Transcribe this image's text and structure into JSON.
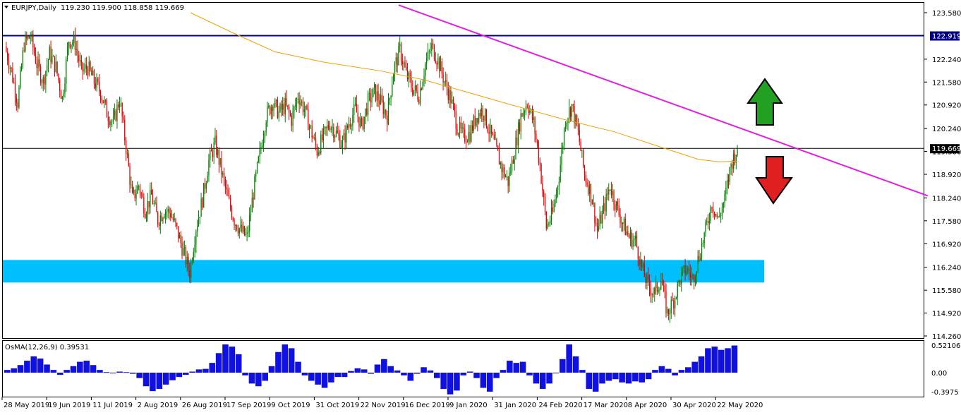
{
  "header": {
    "symbol_label": "EURJPY,Daily",
    "ohlc_text": "119.230 119.900 118.858 119.669"
  },
  "indicator": {
    "label": "OsMA(12,26,9) 0.39531",
    "ticks": [
      "0.52106",
      "0.00",
      "-0.3975"
    ]
  },
  "colors": {
    "background": "#ffffff",
    "bull_candle": "#008000",
    "bear_candle": "#e00000",
    "moving_average": "#f0a000",
    "trendline": "#e020e0",
    "resistance_line": "#000080",
    "support_zone": "#00bfff",
    "osma_histogram": "#1010e0",
    "arrow_up": "#22a022",
    "arrow_down": "#e02020"
  },
  "chart_data": {
    "type": "candlestick",
    "symbol": "EURJPY",
    "timeframe": "Daily",
    "ylim": [
      114.26,
      123.58
    ],
    "yticks": [
      "123.580",
      "122.240",
      "121.580",
      "120.920",
      "120.240",
      "119.580",
      "118.920",
      "118.240",
      "117.580",
      "116.920",
      "116.240",
      "115.580",
      "114.920",
      "114.260"
    ],
    "xlabels": [
      "28 May 2019",
      "19 Jun 2019",
      "11 Jul 2019",
      "2 Aug 2019",
      "26 Aug 2019",
      "17 Sep 2019",
      "9 Oct 2019",
      "31 Oct 2019",
      "22 Nov 2019",
      "16 Dec 2019",
      "9 Jan 2020",
      "31 Jan 2020",
      "24 Feb 2020",
      "17 Mar 2020",
      "8 Apr 2020",
      "30 Apr 2020",
      "22 May 2020"
    ],
    "price_markers": {
      "resistance": "122.919",
      "current": "119.669"
    },
    "price_path": [
      122.6,
      121.9,
      121.0,
      122.7,
      122.9,
      122.1,
      121.6,
      122.4,
      122.0,
      121.1,
      122.8,
      122.7,
      121.9,
      122.0,
      121.6,
      121.3,
      120.7,
      120.4,
      121.1,
      119.7,
      118.2,
      118.6,
      117.9,
      118.3,
      117.6,
      117.9,
      117.8,
      117.3,
      116.7,
      116.1,
      117.4,
      118.2,
      119.3,
      119.8,
      119.0,
      118.2,
      117.6,
      117.3,
      117.1,
      118.4,
      119.5,
      120.6,
      121.0,
      120.7,
      120.9,
      120.5,
      121.2,
      120.8,
      120.2,
      119.6,
      120.0,
      120.4,
      120.1,
      119.8,
      120.4,
      120.8,
      120.3,
      121.0,
      121.3,
      121.0,
      120.6,
      121.9,
      122.5,
      121.8,
      121.4,
      121.2,
      122.1,
      122.6,
      122.2,
      121.6,
      121.1,
      120.3,
      120.0,
      120.1,
      120.6,
      120.8,
      120.2,
      119.7,
      119.1,
      118.7,
      119.6,
      120.6,
      121.0,
      120.4,
      119.2,
      117.4,
      117.8,
      118.9,
      120.5,
      120.9,
      120.1,
      118.9,
      118.4,
      117.3,
      117.9,
      118.6,
      118.0,
      117.5,
      117.1,
      117.0,
      116.2,
      115.7,
      115.5,
      115.9,
      114.9,
      115.3,
      115.9,
      116.2,
      115.9,
      116.6,
      117.3,
      118.1,
      117.6,
      118.2,
      119.2,
      119.7
    ],
    "ma_path": [
      null,
      null,
      null,
      null,
      null,
      null,
      null,
      null,
      null,
      null,
      null,
      null,
      null,
      null,
      null,
      null,
      null,
      null,
      null,
      null,
      null,
      null,
      null,
      null,
      null,
      null,
      null,
      null,
      null,
      null,
      null,
      null,
      null,
      null,
      null,
      null,
      null,
      null,
      null,
      null,
      null,
      null,
      null,
      null,
      null,
      null,
      null,
      null,
      null,
      null,
      null,
      null,
      null,
      null,
      null,
      null,
      null,
      null,
      null,
      null,
      null,
      null,
      null,
      null,
      null,
      null,
      null,
      null,
      null,
      null,
      null,
      null,
      null,
      null,
      null,
      null,
      null,
      null,
      null,
      null,
      null,
      null,
      null,
      null,
      null,
      null,
      null,
      null,
      null,
      null,
      null,
      null,
      null,
      null,
      null,
      null,
      null,
      null,
      null,
      null,
      null,
      null,
      null,
      null,
      null,
      null,
      null,
      null,
      null,
      null,
      null,
      null,
      null,
      null,
      null,
      null,
      null,
      null,
      null,
      null
    ],
    "ma_points": [
      [
        270,
        123.58
      ],
      [
        330,
        123.0
      ],
      [
        390,
        122.45
      ],
      [
        460,
        122.15
      ],
      [
        540,
        121.9
      ],
      [
        600,
        121.65
      ],
      [
        660,
        121.3
      ],
      [
        720,
        120.95
      ],
      [
        800,
        120.5
      ],
      [
        870,
        120.15
      ],
      [
        930,
        119.75
      ],
      [
        990,
        119.35
      ],
      [
        1020,
        119.28
      ],
      [
        1045,
        119.3
      ]
    ],
    "trendline": {
      "from": [
        565,
        123.8
      ],
      "to": [
        1315,
        118.3
      ]
    },
    "support_zone": [
      115.8,
      116.45
    ],
    "osma": [
      0.05,
      0.08,
      0.14,
      0.22,
      0.3,
      0.26,
      0.15,
      0.05,
      -0.04,
      0.05,
      0.12,
      0.2,
      0.22,
      0.14,
      0.05,
      0.01,
      0.0,
      0.02,
      0.01,
      -0.02,
      -0.1,
      -0.25,
      -0.34,
      -0.3,
      -0.22,
      -0.14,
      -0.08,
      -0.04,
      0.02,
      0.06,
      0.07,
      0.18,
      0.36,
      0.52,
      0.48,
      0.34,
      -0.05,
      -0.2,
      -0.25,
      -0.15,
      0.12,
      0.38,
      0.52,
      0.45,
      0.2,
      -0.05,
      -0.15,
      -0.22,
      -0.28,
      -0.18,
      -0.08,
      -0.08,
      0.03,
      0.08,
      0.06,
      -0.02,
      0.15,
      0.25,
      0.12,
      0.04,
      -0.05,
      -0.15,
      -0.02,
      0.1,
      0.04,
      -0.1,
      -0.3,
      -0.4,
      -0.33,
      -0.05,
      0.02,
      -0.1,
      -0.28,
      -0.35,
      -0.1,
      0.05,
      0.22,
      0.18,
      0.2,
      -0.05,
      -0.2,
      -0.3,
      -0.2,
      0.0,
      0.25,
      0.52,
      0.3,
      0.05,
      -0.3,
      -0.35,
      -0.2,
      -0.15,
      -0.12,
      -0.18,
      -0.2,
      -0.16,
      -0.18,
      -0.12,
      0.05,
      0.12,
      0.07,
      -0.05,
      0.05,
      0.1,
      0.2,
      0.3,
      0.45,
      0.48,
      0.42,
      0.45,
      0.5
    ]
  }
}
